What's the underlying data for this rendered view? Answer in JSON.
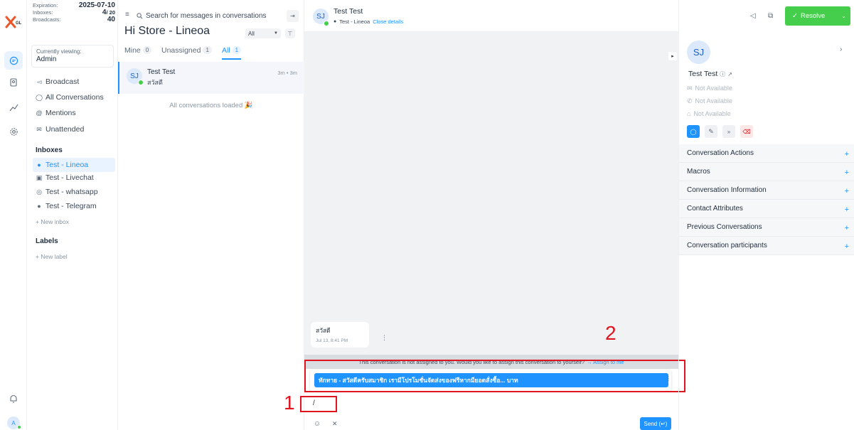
{
  "account": {
    "expiration_label": "Expiration:",
    "expiration_value": "2025-07-10",
    "inboxes_label": "Inboxes:",
    "inboxes_value": "4",
    "inboxes_total": "/ 20",
    "broadcasts_label": "Broadcasts:",
    "broadcasts_value": "40"
  },
  "rail": {
    "avatar_initial": "A"
  },
  "nav": {
    "viewing_label": "Currently viewing:",
    "viewing_value": "Admin",
    "items": [
      {
        "label": "Broadcast",
        "icon": "megaphone-icon"
      },
      {
        "label": "All Conversations",
        "icon": "chat-icon"
      },
      {
        "label": "Mentions",
        "icon": "at-icon"
      },
      {
        "label": "Unattended",
        "icon": "mail-icon"
      }
    ],
    "inboxes_heading": "Inboxes",
    "inboxes": [
      {
        "label": "Test - Lineoa",
        "icon": "line-icon"
      },
      {
        "label": "Test - Livechat",
        "icon": "livechat-icon"
      },
      {
        "label": "Test - whatsapp",
        "icon": "whatsapp-icon"
      },
      {
        "label": "Test - Telegram",
        "icon": "telegram-icon"
      }
    ],
    "new_inbox": "+ New inbox",
    "labels_heading": "Labels",
    "new_label": "+ New label"
  },
  "list": {
    "search_placeholder": "Search for messages in conversations",
    "title": "Hi Store - Lineoa",
    "filter_value": "All",
    "tabs": [
      {
        "label": "Mine",
        "count": "0"
      },
      {
        "label": "Unassigned",
        "count": "1"
      },
      {
        "label": "All",
        "count": "1"
      }
    ],
    "conversation": {
      "initials": "SJ",
      "name": "Test Test",
      "preview": "สวัสดี",
      "time": "3m • 3m"
    },
    "loaded_text": "All conversations loaded 🎉"
  },
  "chat": {
    "header_initials": "SJ",
    "header_name": "Test Test",
    "header_inbox": "Test - Lineoa",
    "close_details": "Close details",
    "resolve_label": "Resolve",
    "message_text": "สวัสดี",
    "message_time": "Jul 13, 8:41 PM",
    "assign_notice": "This conversation is not assigned to you. Would you like to assign this conversation to yourself?",
    "assign_link": "→ Assign to me",
    "canned_suggestion": "ทักทาย - สวัสดีครับสมาชิก เรามีโปรโมชั่นจัดส่งของฟรีหากมียอดสั่งซื้อ... บาท",
    "composer_value": "/",
    "send_label": "Send (↵)",
    "annotation_1": "1",
    "annotation_2": "2"
  },
  "contact": {
    "initials": "SJ",
    "name": "Test Test",
    "email": "Not Available",
    "phone": "Not Available",
    "company": "Not Available",
    "sections": [
      "Conversation Actions",
      "Macros",
      "Conversation Information",
      "Contact Attributes",
      "Previous Conversations",
      "Conversation participants"
    ]
  },
  "colors": {
    "accent": "#1f93ff",
    "resolve": "#44ce4b",
    "annotation": "#e0141e"
  }
}
